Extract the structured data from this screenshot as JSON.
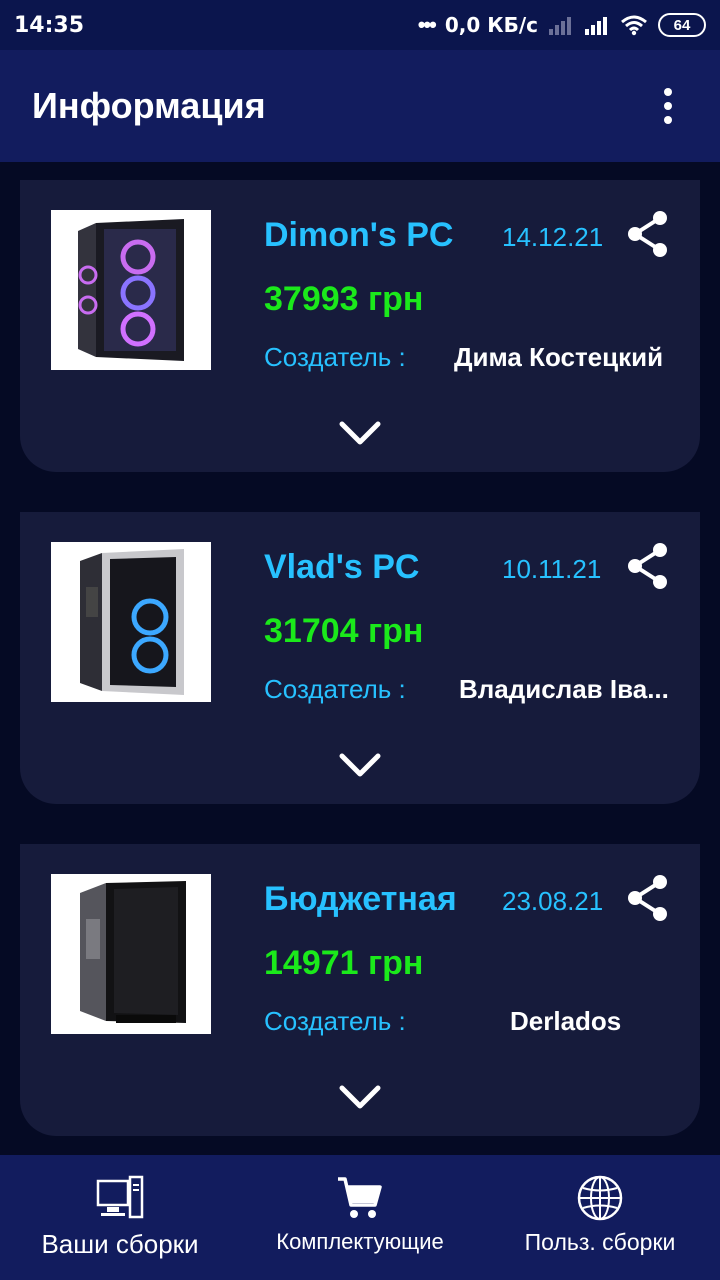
{
  "status_bar": {
    "time": "14:35",
    "dots": "•••",
    "speed": "0,0 КБ/с",
    "battery": "64"
  },
  "app_bar": {
    "title": "Информация",
    "menu_icon": "more-vert-icon"
  },
  "builds": [
    {
      "name": "Dimon's PC",
      "date": "14.12.21",
      "price": "37993 грн",
      "creator_label": "Создатель :",
      "creator": "Дима Костецкий",
      "image": "pc-case-rgb-fans"
    },
    {
      "name": "Vlad's PC",
      "date": "10.11.21",
      "price": "31704 грн",
      "creator_label": "Создатель :",
      "creator": "Владислав Іва...",
      "image": "pc-case-blue-fans"
    },
    {
      "name": "Бюджетная",
      "date": "23.08.21",
      "price": "14971 грн",
      "creator_label": "Создатель :",
      "creator": "Derlados",
      "image": "pc-case-dark"
    }
  ],
  "bottom_nav": [
    {
      "label": "Ваши сборки",
      "icon": "desktop-pc-icon"
    },
    {
      "label": "Комплектующие",
      "icon": "cart-icon"
    },
    {
      "label": "Польз. сборки",
      "icon": "globe-icon"
    }
  ],
  "colors": {
    "app_bar": "#121c5e",
    "background": "#050a24",
    "card": "#161b3b",
    "name": "#27c1ff",
    "price": "#1be91b"
  }
}
